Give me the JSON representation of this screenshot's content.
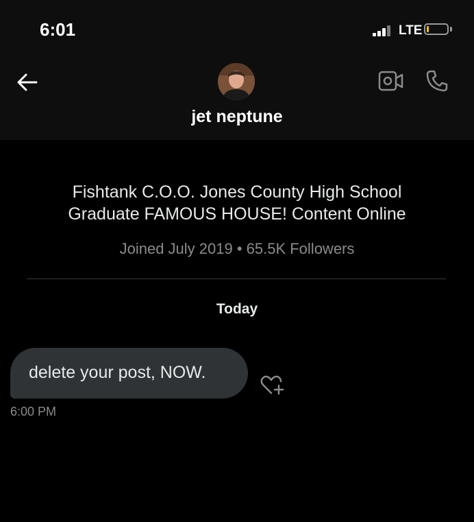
{
  "status_bar": {
    "time": "6:01",
    "carrier": "LTE",
    "battery_level": 0.12,
    "battery_color": "#f5c400"
  },
  "header": {
    "back_icon": "arrow-left-icon",
    "contact_name": "jet neptune",
    "video_icon": "video-camera-icon",
    "call_icon": "phone-icon"
  },
  "profile": {
    "bio_line_1": "Fishtank C.O.O. Jones County High School",
    "bio_line_2": "Graduate FAMOUS HOUSE! Content Online",
    "meta": "Joined July 2019 • 65.5K Followers"
  },
  "conversation": {
    "day_label": "Today",
    "messages": [
      {
        "text": "delete your post, NOW.",
        "time": "6:00 PM",
        "reaction_icon": "heart-plus-icon"
      }
    ]
  },
  "colors": {
    "background": "#000000",
    "header_bg": "#0e0e0e",
    "bubble_bg": "#2f3336",
    "secondary_text": "#8b8b8b"
  }
}
